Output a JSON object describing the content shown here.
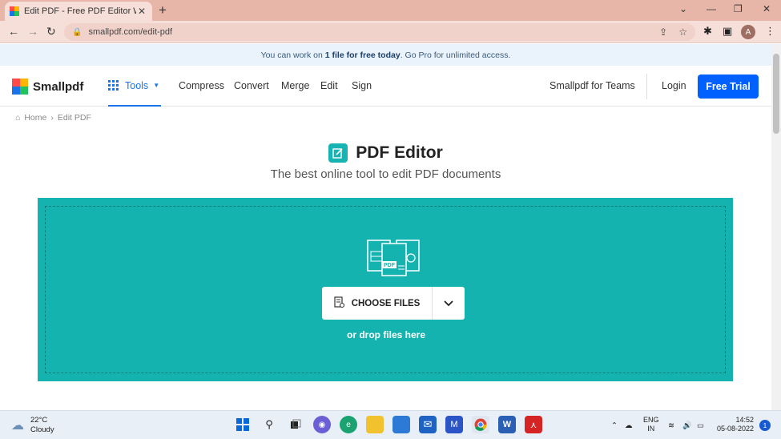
{
  "browser": {
    "tab_title": "Edit PDF - Free PDF Editor Working",
    "url": "smallpdf.com/edit-pdf",
    "profile_initial": "A"
  },
  "banner": {
    "prefix": "You can work on ",
    "bold": "1 file for free today",
    "suffix": ". Go Pro for unlimited access."
  },
  "nav": {
    "logo": "Smallpdf",
    "tools": "Tools",
    "links": [
      "Compress",
      "Convert",
      "Merge",
      "Edit",
      "Sign"
    ],
    "teams": "Smallpdf for Teams",
    "login": "Login",
    "free_trial": "Free Trial"
  },
  "breadcrumb": {
    "home": "Home",
    "separator": "›",
    "current": "Edit PDF"
  },
  "hero": {
    "title": "PDF Editor",
    "subtitle": "The best online tool to edit PDF documents"
  },
  "dropzone": {
    "choose_files": "CHOOSE FILES",
    "drop_hint": "or drop files here",
    "art_label": "PDF"
  },
  "taskbar": {
    "temperature": "22°C",
    "condition": "Cloudy",
    "lang_1": "ENG",
    "lang_2": "IN",
    "time": "14:52",
    "date": "05-08-2022",
    "notifications": "1"
  },
  "colors": {
    "accent": "#0061fe",
    "teal": "#14b3b0",
    "tab_bar": "#e8b6a8"
  }
}
